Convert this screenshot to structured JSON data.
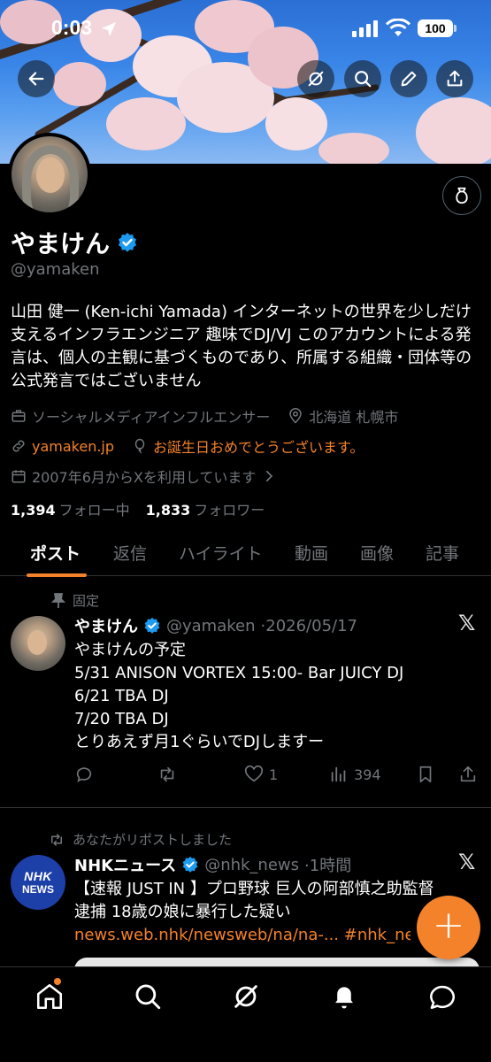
{
  "status_bar": {
    "time": "0:03",
    "battery": "100"
  },
  "profile": {
    "display_name": "やまけん",
    "handle": "@yamaken",
    "bio": "山田 健一 (Ken-ichi Yamada) インターネットの世界を少しだけ支えるインフラエンジニア 趣味でDJ/VJ このアカウントによる発言は、個人の主観に基づくものであり、所属する組織・団体等の公式発言ではございません",
    "category": "ソーシャルメディアインフルエンサー",
    "location": "北海道 札幌市",
    "website": "yamaken.jp",
    "birthday": "お誕生日おめでとうございます。",
    "joined": "2007年6月からXを利用しています",
    "following_count": "1,394",
    "following_label": "フォロー中",
    "followers_count": "1,833",
    "followers_label": "フォロワー"
  },
  "tabs": [
    "ポスト",
    "返信",
    "ハイライト",
    "動画",
    "画像",
    "記事"
  ],
  "pinned_post": {
    "label": "固定",
    "name": "やまけん",
    "handle": "@yamaken",
    "date": "·2026/05/17",
    "lines": [
      "やまけんの予定",
      "5/31 ANISON VORTEX 15:00- Bar JUICY DJ",
      "6/21 TBA DJ",
      "7/20 TBA DJ",
      "とりあえず月1ぐらいでDJしますー"
    ],
    "likes": "1",
    "views": "394"
  },
  "repost": {
    "label": "あなたがリポストしました",
    "avatar_line1": "NHK",
    "avatar_line2": "NEWS",
    "name": "NHKニュース",
    "handle": "@nhk_news",
    "time": "·1時間",
    "line1": "【速報 JUST IN 】プロ野球 巨人の阿部慎之助監督",
    "line2": "逮捕 18歳の娘に暴行した疑い",
    "link": "news.web.nhk/newsweb/na/na-... #nhk_ne"
  },
  "x_mark": "𝕏",
  "fab_label": "+",
  "colors": {
    "accent": "#f4822a",
    "verified": "#1d9bf0",
    "muted": "#71767b",
    "border": "#2f3336"
  },
  "icons": [
    "back-icon",
    "grok-icon",
    "search-icon",
    "edit-icon",
    "share-icon",
    "more-icon"
  ]
}
